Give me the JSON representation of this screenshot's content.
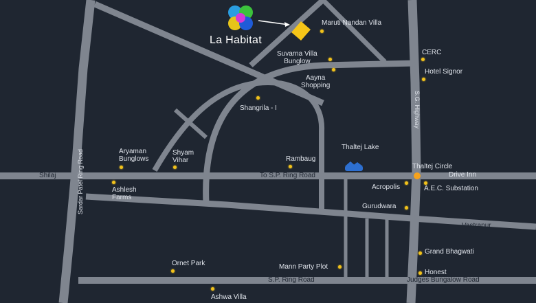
{
  "brand": {
    "name": "La Habitat"
  },
  "colors": {
    "background": "#1f2631",
    "road": "#8a8f99",
    "marker": "#f2c21b",
    "site": "#f5c518",
    "label": "#dfe3ea"
  },
  "roads": {
    "sardar_patel_ring_road": "Sardar Patel Ring Road",
    "sg_highway": "S.G. Highway",
    "to_sp_ring_road": "To S.P. Ring Road",
    "sp_ring_road": "S.P. Ring Road",
    "judges_bungalow_road": "Judges Bungalow Road",
    "shilaj": "Shilaj",
    "vastrapur": "Vastrapur"
  },
  "places": {
    "maruti_nandan_villa": "Maruti Nandan Villa",
    "suvarna_villa_bungalow": [
      "Suvarna Villa",
      "Bunglow"
    ],
    "aayna_shopping": [
      "Aayna",
      "Shopping"
    ],
    "cerc": "CERC",
    "hotel_signor": "Hotel Signor",
    "shangrila": "Shangrila - I",
    "aryaman_bunglows": [
      "Aryaman",
      "Bunglows"
    ],
    "shyam_vihar": [
      "Shyam",
      "Vihar"
    ],
    "rambaug": "Rambaug",
    "thaltej_lake": "Thaltej Lake",
    "thaltej_circle": "Thaltej Circle",
    "drive_inn": "Drive Inn",
    "ashlesh_farms": [
      "Ashlesh",
      "Farms"
    ],
    "acropolis": "Acropolis",
    "aec_substation": "A.E.C. Substation",
    "gurudwara": "Gurudwara",
    "grand_bhagwati": "Grand Bhagwati",
    "ornet_park": "Ornet Park",
    "mann_party_plot": "Mann Party Plot",
    "honest": "Honest",
    "ashwa_villa": "Ashwa Villa"
  }
}
